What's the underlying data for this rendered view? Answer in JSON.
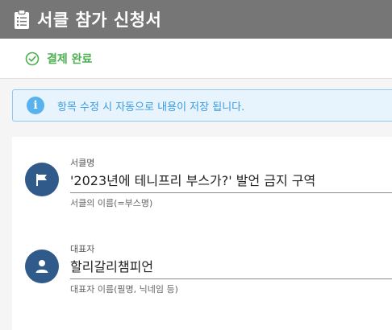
{
  "header": {
    "title": "서클 참가 신청서",
    "icon": "clipboard-icon"
  },
  "status": {
    "label": "결제 완료",
    "icon": "check-circle-icon",
    "color": "#4caf50"
  },
  "notice": {
    "text": "항목 수정 시 자동으로 내용이 저장 됩니다.",
    "icon": "info-icon"
  },
  "fields": {
    "circle": {
      "label": "서클명",
      "value": "'2023년에 테니프리 부스가?' 발언 금지 구역",
      "hint": "서클의 이름(=부스명)",
      "icon": "flag-icon"
    },
    "rep": {
      "label": "대표자",
      "value": "할리갈리챔피언",
      "hint": "대표자 이름(필명, 닉네임 등)",
      "icon": "person-icon"
    }
  }
}
